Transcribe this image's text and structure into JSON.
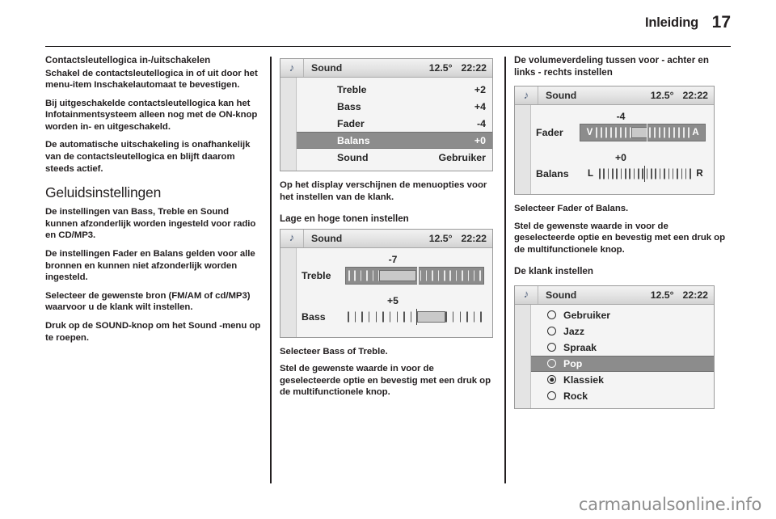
{
  "header": {
    "title": "Inleiding",
    "page_number": "17"
  },
  "left_column": {
    "heading_1": "Contactsleutellogica in-/uitschakelen",
    "paragraphs_1": [
      "Schakel de contactsleutellogica in of uit door het menu-item Inschakelautomaat te bevestigen.",
      "Bij uitgeschakelde contactsleutellogica kan het Infotainmentsysteem alleen nog met de ON-knop worden in- en uitgeschakeld.",
      "De automatische uitschakeling is onafhankelijk van de contactsleutellogica en blijft daarom steeds actief."
    ],
    "section_title": "Geluidsinstellingen",
    "paragraphs_2": [
      "De instellingen van Bass, Treble en Sound kunnen afzonderlijk worden ingesteld voor radio en CD/MP3.",
      "De instellingen Fader en Balans gelden voor alle bronnen en kunnen niet afzonderlijk worden ingesteld.",
      "Selecteer de gewenste bron (FM/AM of cd/MP3) waarvoor u de klank wilt instellen.",
      "Druk op de SOUND-knop om het Sound -menu op te roepen."
    ]
  },
  "middle_column": {
    "display_menu": {
      "icon": "music-note-icon",
      "title": "Sound",
      "temperature": "12.5°",
      "clock": "22:22",
      "rows": [
        {
          "label": "Treble",
          "value": "+2",
          "selected": false
        },
        {
          "label": "Bass",
          "value": "+4",
          "selected": false
        },
        {
          "label": "Fader",
          "value": "-4",
          "selected": false
        },
        {
          "label": "Balans",
          "value": "+0",
          "selected": true
        },
        {
          "label": "Sound",
          "value": "Gebruiker",
          "selected": false
        }
      ]
    },
    "caption_1": "Op het display verschijnen de menuopties voor het instellen van de klank.",
    "heading_1": "Lage en hoge tonen instellen",
    "display_sliders": {
      "icon": "music-note-icon",
      "title": "Sound",
      "temperature": "12.5°",
      "clock": "22:22",
      "sliders": [
        {
          "name": "Treble",
          "value": "-7",
          "framed": true,
          "percent": 32
        },
        {
          "name": "Bass",
          "value": "+5",
          "framed": false,
          "percent": 63
        }
      ]
    },
    "paragraphs": [
      "Selecteer Bass of Treble.",
      "Stel de gewenste waarde in voor de geselecteerde optie en bevestig met een druk op de multifunctionele knop."
    ]
  },
  "right_column": {
    "heading_1": "De volumeverdeling tussen voor - achter en links - rechts instellen",
    "display_fader": {
      "icon": "music-note-icon",
      "title": "Sound",
      "temperature": "12.5°",
      "clock": "22:22",
      "sliders": [
        {
          "name": "Fader",
          "value": "-4",
          "left_cap": "V",
          "right_cap": "A",
          "framed": true,
          "percent": 46
        },
        {
          "name": "Balans",
          "value": "+0",
          "left_cap": "L",
          "right_cap": "R",
          "framed": false,
          "percent": 50
        }
      ]
    },
    "paragraphs": [
      "Selecteer Fader of Balans.",
      "Stel de gewenste waarde in voor de geselecteerde optie en bevestig met een druk op de multifunctionele knop."
    ],
    "heading_2": "De klank instellen",
    "display_presets": {
      "icon": "music-note-icon",
      "title": "Sound",
      "temperature": "12.5°",
      "clock": "22:22",
      "options": [
        {
          "label": "Gebruiker",
          "selected": false,
          "checked": false
        },
        {
          "label": "Jazz",
          "selected": false,
          "checked": false
        },
        {
          "label": "Spraak",
          "selected": false,
          "checked": false
        },
        {
          "label": "Pop",
          "selected": true,
          "checked": false
        },
        {
          "label": "Klassiek",
          "selected": false,
          "checked": true
        },
        {
          "label": "Rock",
          "selected": false,
          "checked": false
        }
      ]
    }
  },
  "footer": {
    "watermark": "carmanualsonline.info"
  }
}
